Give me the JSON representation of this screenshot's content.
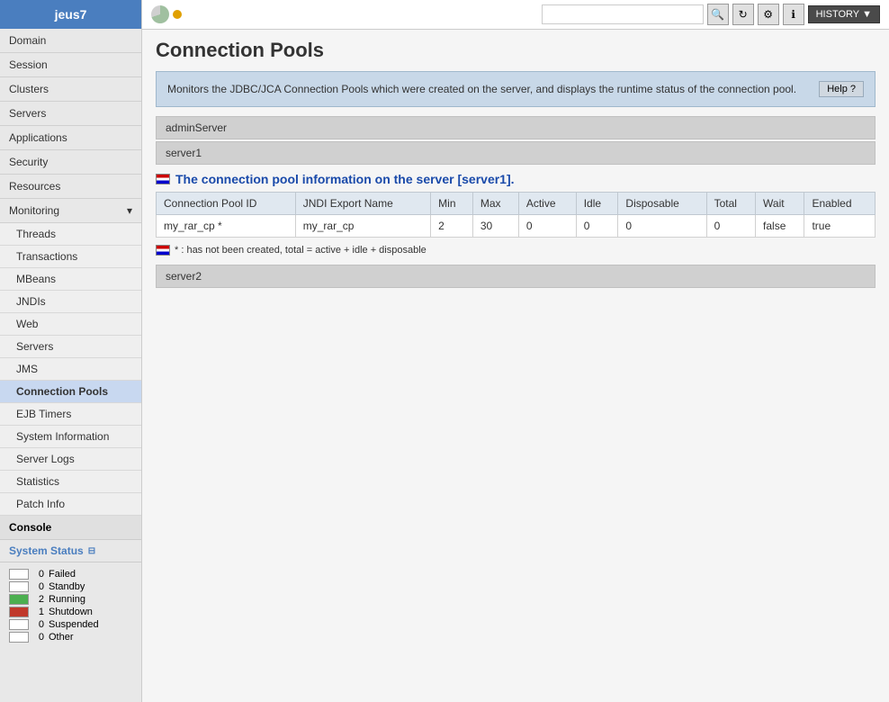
{
  "sidebar": {
    "username": "jeus7",
    "nav_items": [
      {
        "id": "domain",
        "label": "Domain"
      },
      {
        "id": "session",
        "label": "Session"
      },
      {
        "id": "clusters",
        "label": "Clusters"
      },
      {
        "id": "servers",
        "label": "Servers"
      },
      {
        "id": "applications",
        "label": "Applications"
      },
      {
        "id": "security",
        "label": "Security"
      },
      {
        "id": "resources",
        "label": "Resources"
      }
    ],
    "monitoring_label": "Monitoring",
    "monitoring_items": [
      {
        "id": "threads",
        "label": "Threads"
      },
      {
        "id": "transactions",
        "label": "Transactions"
      },
      {
        "id": "mbeans",
        "label": "MBeans"
      },
      {
        "id": "jndis",
        "label": "JNDIs"
      },
      {
        "id": "web",
        "label": "Web"
      },
      {
        "id": "servers-mon",
        "label": "Servers"
      },
      {
        "id": "jms",
        "label": "JMS"
      },
      {
        "id": "connection-pools",
        "label": "Connection Pools",
        "active": true
      },
      {
        "id": "ejb-timers",
        "label": "EJB Timers"
      },
      {
        "id": "system-information",
        "label": "System Information"
      },
      {
        "id": "server-logs",
        "label": "Server Logs"
      },
      {
        "id": "statistics",
        "label": "Statistics"
      },
      {
        "id": "patch-info",
        "label": "Patch Info"
      }
    ],
    "console_label": "Console",
    "system_status_label": "System Status",
    "status_items": [
      {
        "id": "failed",
        "label": "Failed",
        "count": 0,
        "style": "failed"
      },
      {
        "id": "standby",
        "label": "Standby",
        "count": 0,
        "style": "standby"
      },
      {
        "id": "running",
        "label": "Running",
        "count": 2,
        "style": "running"
      },
      {
        "id": "shutdown",
        "label": "Shutdown",
        "count": 1,
        "style": "shutdown"
      },
      {
        "id": "suspended",
        "label": "Suspended",
        "count": 0,
        "style": "suspended"
      },
      {
        "id": "other",
        "label": "Other",
        "count": 0,
        "style": "other"
      }
    ]
  },
  "header": {
    "history_label": "HISTORY",
    "history_arrow": "▼"
  },
  "main": {
    "page_title": "Connection Pools",
    "search_placeholder": "",
    "info_text": "Monitors the JDBC/JCA Connection Pools which were created on the server, and displays the runtime status of the connection pool.",
    "help_label": "Help ?",
    "servers": [
      {
        "name": "adminServer"
      },
      {
        "name": "server1",
        "section_title": "The connection pool information on the server [server1].",
        "table_headers": [
          "Connection Pool ID",
          "JNDI Export Name",
          "Min",
          "Max",
          "Active",
          "Idle",
          "Disposable",
          "Total",
          "Wait",
          "Enabled"
        ],
        "table_rows": [
          {
            "pool_id": "my_rar_cp *",
            "jndi_name": "my_rar_cp",
            "min": "2",
            "max": "30",
            "active": "0",
            "idle": "0",
            "disposable": "0",
            "total": "0",
            "wait": "false",
            "enabled": "true"
          }
        ],
        "legend": "* : has not been created, total = active + idle + disposable"
      },
      {
        "name": "server2"
      }
    ]
  }
}
